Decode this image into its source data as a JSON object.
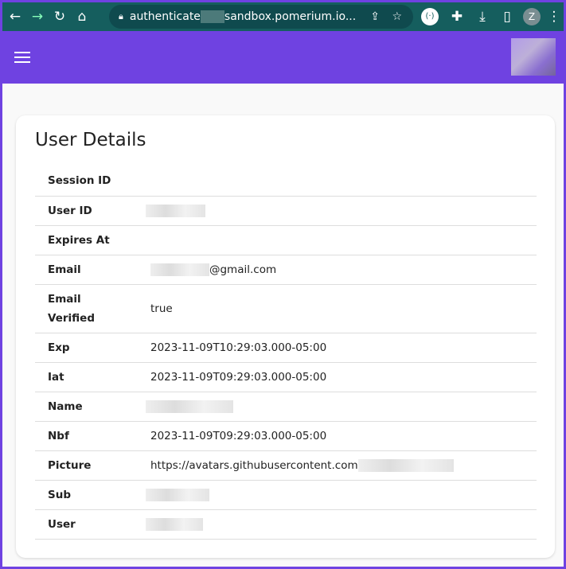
{
  "browser": {
    "url_prefix": "authenticate",
    "url_suffix": "sandbox.pomerium.io...",
    "profile_initial": "Z"
  },
  "page": {
    "title": "User Details"
  },
  "rows": [
    {
      "key": "Session ID",
      "value": ""
    },
    {
      "key": "User ID",
      "value": "",
      "redacted": true
    },
    {
      "key": "Expires At",
      "value": ""
    },
    {
      "key": "Email",
      "value": "@gmail.com",
      "redacted_prefix": true
    },
    {
      "key": "Email Verified",
      "value": "true"
    },
    {
      "key": "Exp",
      "value": "2023-11-09T10:29:03.000-05:00"
    },
    {
      "key": "Iat",
      "value": "2023-11-09T09:29:03.000-05:00"
    },
    {
      "key": "Name",
      "value": "",
      "redacted": true
    },
    {
      "key": "Nbf",
      "value": "2023-11-09T09:29:03.000-05:00"
    },
    {
      "key": "Picture",
      "value": "https://avatars.githubusercontent.com",
      "redacted_suffix": true
    },
    {
      "key": "Sub",
      "value": "",
      "redacted": true
    },
    {
      "key": "User",
      "value": "",
      "redacted": true
    }
  ]
}
